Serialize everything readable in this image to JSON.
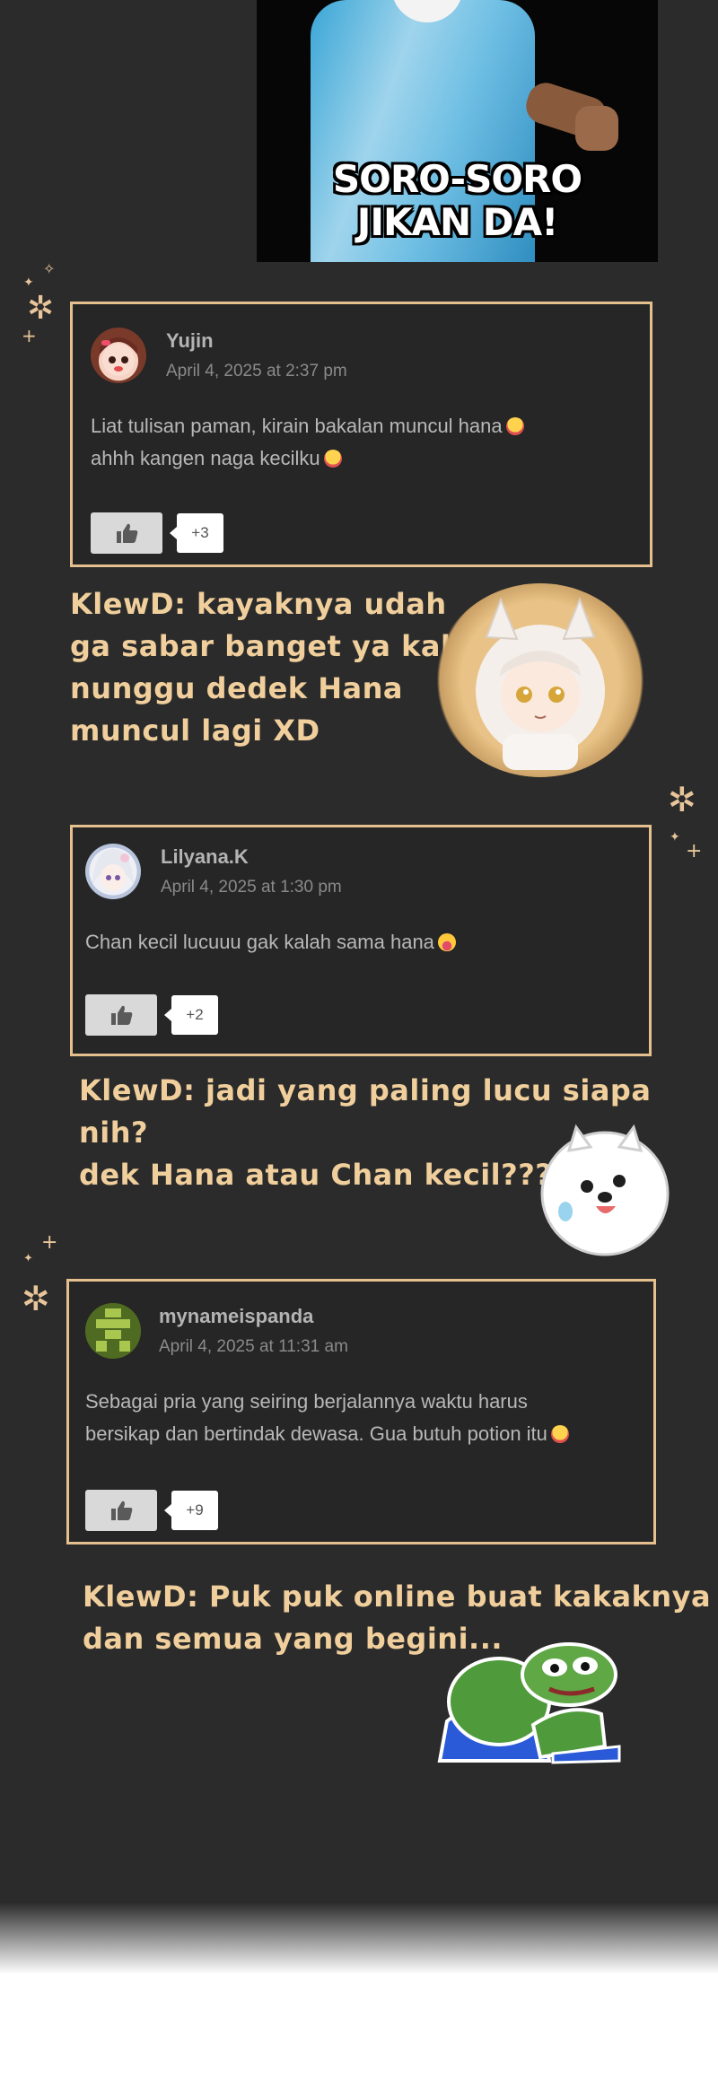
{
  "meme": {
    "caption_line1": "SORO-SORO",
    "caption_line2": "JIKAN DA!"
  },
  "comments": [
    {
      "username": "Yujin",
      "date": "April 4, 2025 at 2:37 pm",
      "line1": "Liat tulisan paman, kirain bakalan muncul hana",
      "line2": "ahhh kangen naga kecilku",
      "likes": "+3",
      "emoji": "crying-face"
    },
    {
      "username": "Lilyana.K",
      "date": "April 4, 2025 at 1:30 pm",
      "line1": "Chan kecil lucuuu gak kalah sama hana",
      "line2": "",
      "likes": "+2",
      "emoji": "grinning-face"
    },
    {
      "username": "mynameispanda",
      "date": "April 4, 2025 at 11:31 am",
      "line1": "Sebagai pria yang seiring berjalannya waktu harus",
      "line2": "bersikap dan bertindak dewasa. Gua butuh potion itu",
      "likes": "+9",
      "emoji": "crying-face"
    }
  ],
  "replies": [
    {
      "line1": "KlewD: kayaknya udah",
      "line2": "ga sabar banget ya kak",
      "line3": "nunggu dedek Hana",
      "line4": "muncul lagi XD"
    },
    {
      "line1": "KlewD: jadi yang paling lucu siapa nih?",
      "line2": "dek Hana atau Chan kecil????"
    },
    {
      "line1": "KlewD: Puk puk online buat kakaknya",
      "line2": "dan semua yang begini..."
    }
  ],
  "colors": {
    "background": "#2b2b2b",
    "accent": "#e5c08e",
    "reply_text": "#f0cf9c"
  }
}
